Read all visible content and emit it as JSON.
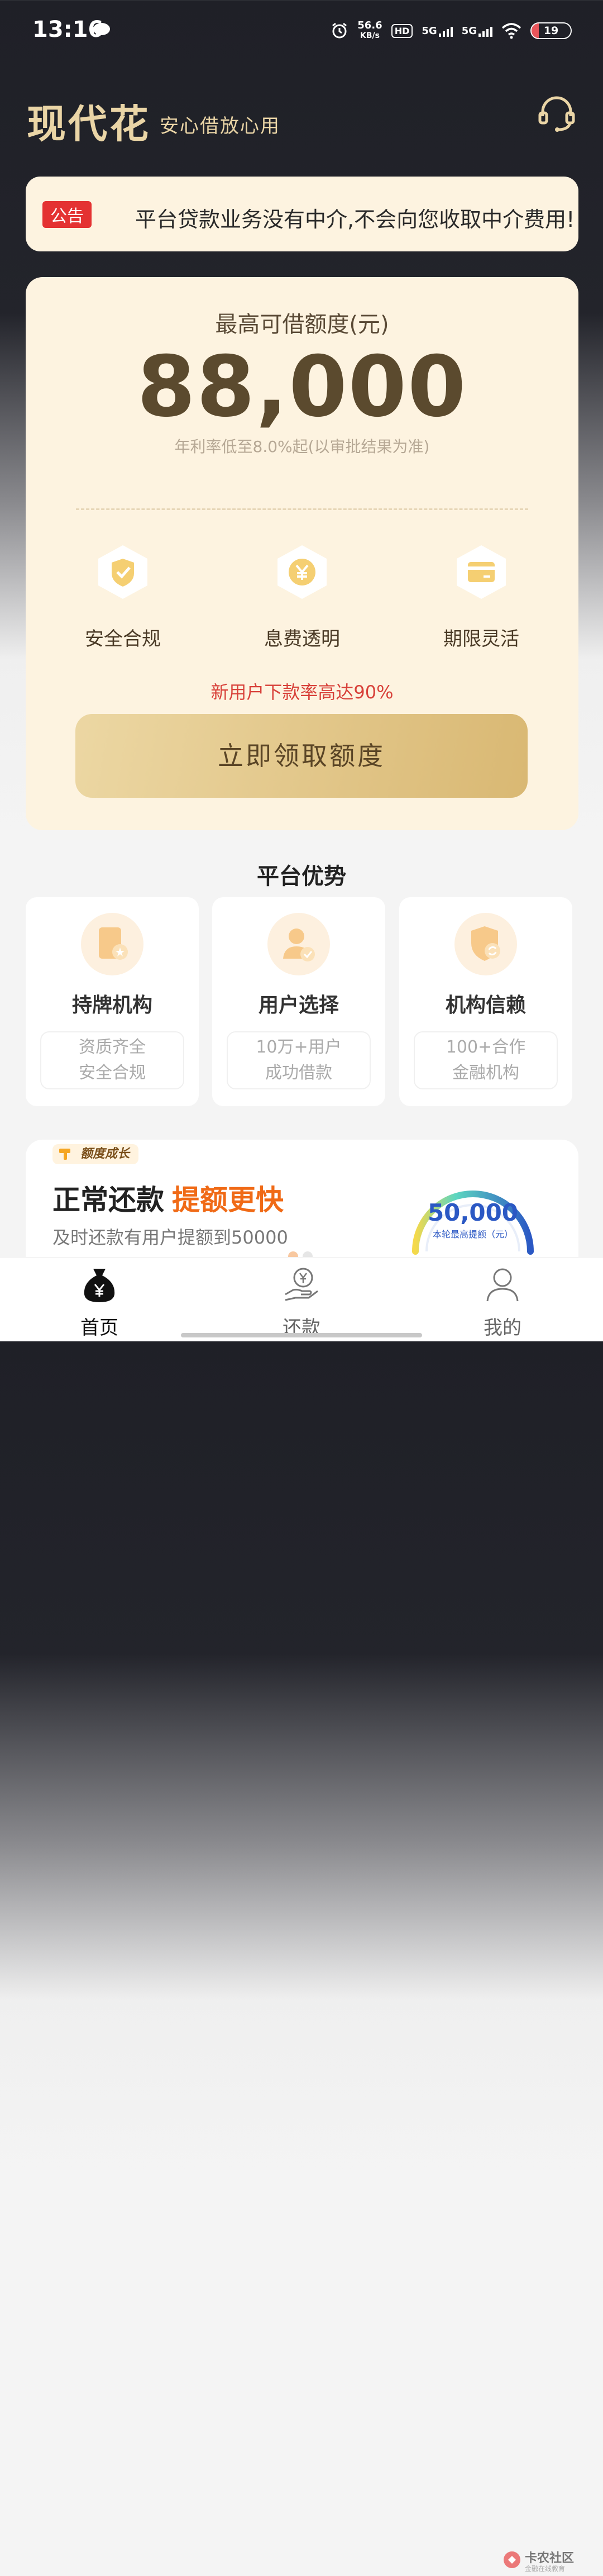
{
  "status_bar": {
    "time": "13:16",
    "net_speed_value": "56.6",
    "net_speed_unit": "KB/s",
    "hd_label": "HD",
    "signal1": "5G",
    "signal2": "5G",
    "battery": "19"
  },
  "header": {
    "brand": "现代花",
    "slogan": "安心借放心用",
    "support_icon": "headset-icon"
  },
  "notice": {
    "tag": "公告",
    "text": "平台贷款业务没有中介,不会向您收取中介费用!"
  },
  "quota_card": {
    "label": "最高可借额度(元)",
    "amount": "88,000",
    "rate_note": "年利率低至8.0%起(以审批结果为准)",
    "features": [
      {
        "label": "安全合规",
        "icon": "shield-check-icon"
      },
      {
        "label": "息费透明",
        "icon": "yuan-coin-icon"
      },
      {
        "label": "期限灵活",
        "icon": "card-icon"
      }
    ],
    "promo": "新用户下款率高达90%",
    "button": "立即领取额度"
  },
  "advantages": {
    "title": "平台优势",
    "cards": [
      {
        "title": "持牌机构",
        "desc1": "资质齐全",
        "desc2": "安全合规",
        "icon": "license-icon"
      },
      {
        "title": "用户选择",
        "desc1": "10万+用户",
        "desc2": "成功借款",
        "icon": "user-check-icon"
      },
      {
        "title": "机构信赖",
        "desc1": "100+合作",
        "desc2": "金融机构",
        "icon": "shield-refresh-icon"
      }
    ]
  },
  "growth_banner": {
    "tag": "额度成长",
    "headline_part1": "正常还款",
    "headline_part2": "提额更快",
    "subtitle": "及时还款有用户提额到50000",
    "gauge_value": "50,000",
    "gauge_caption": "本轮最高提额（元）"
  },
  "tabbar": {
    "tabs": [
      {
        "label": "首页",
        "icon": "money-bag-icon",
        "active": true
      },
      {
        "label": "还款",
        "icon": "repay-icon",
        "active": false
      },
      {
        "label": "我的",
        "icon": "profile-icon",
        "active": false
      }
    ]
  },
  "watermark": {
    "line1": "卡农社区",
    "line2": "金融在线教育"
  },
  "colors": {
    "gold": "#ead5a6",
    "card_bg": "#fdf3e0",
    "notice_red": "#e43232",
    "promo_red": "#d8413a",
    "accent_orange": "#f06a16",
    "gauge_blue": "#2b58c4"
  }
}
